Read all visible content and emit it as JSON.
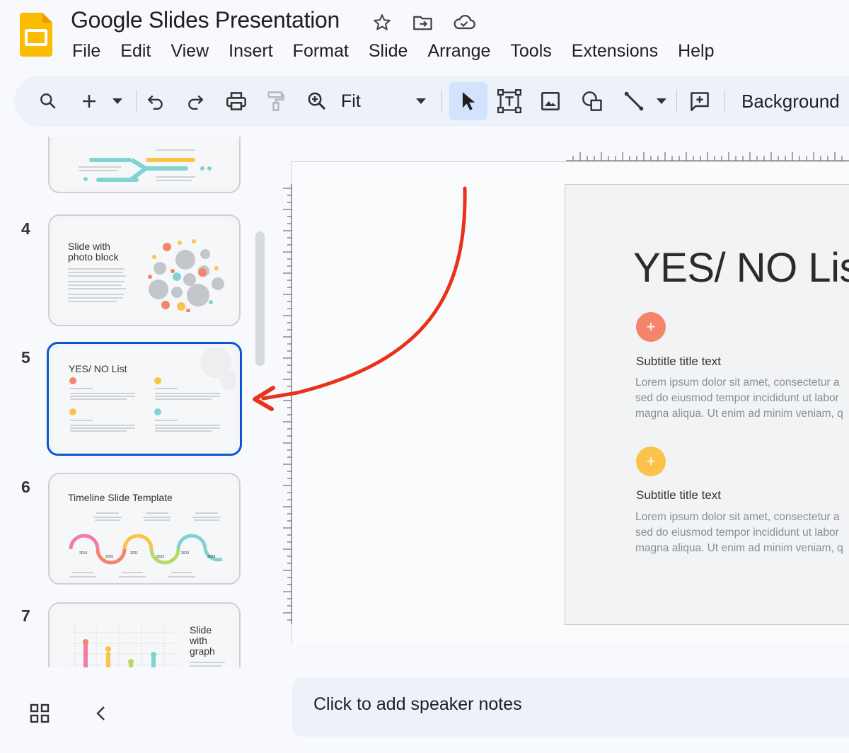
{
  "app": {
    "title": "Google Slides Presentation",
    "brand_color": "#fbbc04"
  },
  "title_icons": [
    "star-icon",
    "move-to-folder-icon",
    "cloud-saved-icon"
  ],
  "menu": [
    "File",
    "Edit",
    "View",
    "Insert",
    "Format",
    "Slide",
    "Arrange",
    "Tools",
    "Extensions",
    "Help"
  ],
  "toolbar": {
    "zoom_value": "Fit",
    "background_label": "Background",
    "active_tool": "select",
    "active_color": "#d3e3fd"
  },
  "filmstrip": {
    "slides": [
      {
        "number": "4",
        "title": "Slide with photo block"
      },
      {
        "number": "5",
        "title": "YES/ NO List",
        "selected": true
      },
      {
        "number": "6",
        "title": "Timeline Slide Template"
      },
      {
        "number": "7",
        "title": "Slide with graph"
      }
    ],
    "thumb4_lines": [
      "Slide with",
      "photo block"
    ],
    "thumb7_lines": [
      "Slide",
      "with",
      "graph"
    ],
    "timeline_years": [
      "2019",
      "2020",
      "2021",
      "2022",
      "2023",
      "2024"
    ],
    "selection_color": "#0b57d0"
  },
  "slide": {
    "title": "YES/ NO Lis",
    "items": [
      {
        "icon": "+",
        "color": "#f4846b",
        "subtitle": "Subtitle title text",
        "lines": [
          "Lorem ipsum dolor sit amet, consectetur a",
          "sed do eiusmod tempor incididunt ut labor",
          "magna aliqua. Ut enim ad minim veniam, q"
        ]
      },
      {
        "icon": "+",
        "color": "#fbc34a",
        "subtitle": "Subtitle title text",
        "lines": [
          "Lorem ipsum dolor sit amet, consectetur a",
          "sed do eiusmod tempor incididunt ut labor",
          "magna aliqua. Ut enim ad minim veniam, q"
        ]
      }
    ]
  },
  "notes": {
    "placeholder": "Click to add speaker notes"
  },
  "annotation": {
    "arrow_color": "#e8321e"
  }
}
